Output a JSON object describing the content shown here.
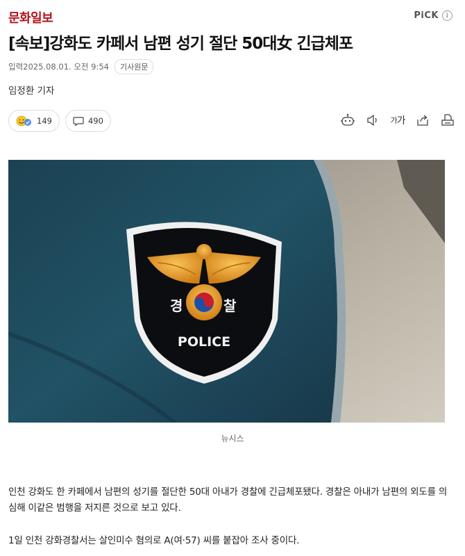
{
  "header": {
    "press_name": "문화일보",
    "pick_label": "PiCK",
    "info_glyph": "i",
    "brand_color": "#b3121e"
  },
  "article": {
    "headline": "[속보]강화도 카페서 남편 성기 절단 50대女 긴급체포",
    "date_label": "입력",
    "date": "2025.08.01. 오전 9:54",
    "original_link_label": "기사원문",
    "reporter": "임정환 기자"
  },
  "reactions": {
    "emotion_count": "149",
    "comment_count": "490"
  },
  "tools": {
    "font_small": "가",
    "font_big": "가",
    "icons": [
      "robot-summary-icon",
      "speaker-icon",
      "font-size-icon",
      "share-icon",
      "print-icon"
    ]
  },
  "photo": {
    "patch_left_char": "경",
    "patch_right_char": "찰",
    "patch_text": "POLICE",
    "uniform_color": "#1d4a5c"
  },
  "caption": "뉴시스",
  "body": {
    "paragraph1": "인천 강화도 한 카페에서 남편의 성기를 절단한 50대 아내가 경찰에 긴급체포됐다. 경찰은 아내가 남편의 외도를 의심해 이같은 범행을 저지른 것으로 보고 있다.",
    "paragraph2": "1일 인천 강화경찰서는 살인미수 혐의로 A(여·57) 씨를 붙잡아 조사 중이다."
  }
}
